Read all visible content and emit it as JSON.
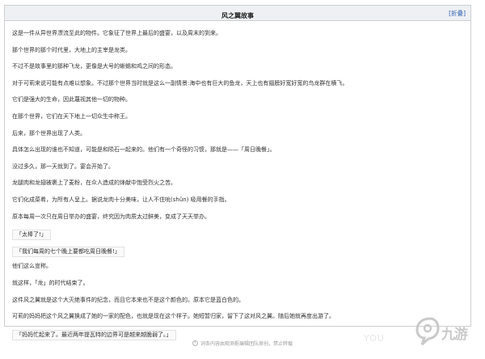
{
  "panel": {
    "title": "风之翼故事",
    "collapse": {
      "left": "[",
      "label": "折叠",
      "right": "]"
    }
  },
  "story": {
    "lines": [
      {
        "text": "这是一件从异世界漂流至此的物件。它象征了世界上最后的盛宴，以及周末的到来。",
        "quote": false
      },
      {
        "text": "那个世界的那个时代里，大地上的主宰是龙类。",
        "quote": false
      },
      {
        "text": "不过不是故事里的那种飞龙，更像是大号的蜥蜴和鸡之间的形态。",
        "quote": false
      },
      {
        "text": "对于可莉来说可能有点难以想象。不过那个世界当时就是这么一副情景:海中也有巨大的鱼龙，天上也有翅膀好宽好宽的鸟龙群在横飞。",
        "quote": false
      },
      {
        "text": "它们是强大的生命，因此蔑视其他一切的物种。",
        "quote": false
      },
      {
        "text": "在那个世界，它们在天下地上一切众生中称王。",
        "quote": false
      },
      {
        "text": "后来，那个世界出现了人类。",
        "quote": false
      },
      {
        "text": "具体怎么出现的谁也不知道，可能是和陨石一起来的。他们有一个奇怪的习惯，那就是——「周日晚餐」。",
        "quote": false
      },
      {
        "text": "没过多久，那一天就到了。宴会开始了。",
        "quote": false
      },
      {
        "text": "龙腿肉和龙翅被裹上了麦粉，在众人造成的烽献中饱受烈火之苦。",
        "quote": false
      },
      {
        "text": "它们化成菜肴，为所有人呈上。据说龙肉十分美味，让人不住吮(shǔn) 吸用餐的手指。",
        "quote": false
      },
      {
        "text": "原本每周一次只在周日举办的盛宴，终究因为肉质太过鲜美，变成了天天举办。",
        "quote": false
      },
      {
        "text": "「太棒了!」",
        "quote": true
      },
      {
        "text": "「我们每周的七个晚上要都吃周日晚餐!」",
        "quote": true
      },
      {
        "text": "他们这么宣称。",
        "quote": false
      },
      {
        "text": "就这样，「龙」的时代结束了。",
        "quote": false
      },
      {
        "text": "这件风之翼就是这个大灭绝事件的纪念，而且它本来也不是这个颜色的。原本它是蓝白色的。",
        "quote": false
      },
      {
        "text": "可莉的妈妈把这个风之翼换成了她的一家的配色，也就是现在这个样子。她短暂归家，留下了这对风之翼。随后她就再度出游了。",
        "quote": false
      },
      {
        "text": "「妈妈忙起来了。最近两年提瓦特的边界可是越来越脆弱了。」",
        "quote": true
      }
    ]
  },
  "footer": {
    "icon": "info-icon",
    "text": "词条内容由观测枢编辑团队原创，禁止转载"
  },
  "watermark": {
    "logo": "jiuyou-logo-icon",
    "text": "九游",
    "faint": "YOU"
  }
}
